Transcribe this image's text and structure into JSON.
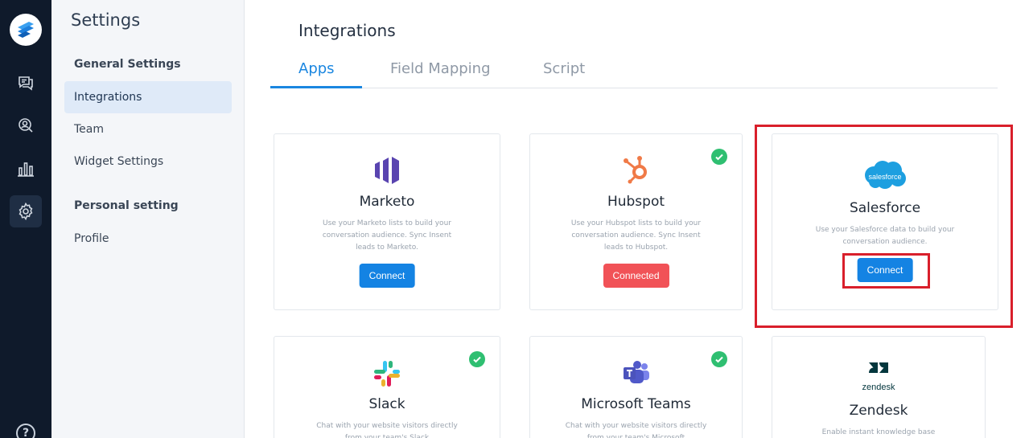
{
  "sidebar": {
    "title": "Settings",
    "groups": [
      {
        "label": "General Settings"
      },
      {
        "label": "Personal setting"
      }
    ],
    "items": [
      {
        "label": "Integrations",
        "active": true
      },
      {
        "label": "Team"
      },
      {
        "label": "Widget Settings"
      },
      {
        "label": "Profile"
      }
    ]
  },
  "rail": {
    "icons": [
      "logo-icon",
      "chat-icon",
      "support-chat-icon",
      "analytics-icon",
      "gear-icon",
      "help-icon"
    ],
    "help_label": "?"
  },
  "main": {
    "title": "Integrations",
    "tabs": [
      {
        "label": "Apps",
        "active": true
      },
      {
        "label": "Field Mapping"
      },
      {
        "label": "Script"
      }
    ],
    "cards": [
      {
        "name": "Marketo",
        "desc": "Use your Marketo lists to build your conversation audience. Sync Insent leads to Marketo.",
        "button": "Connect",
        "connected": false
      },
      {
        "name": "Hubspot",
        "desc": "Use your Hubspot lists to build your conversation audience. Sync Insent leads to Hubspot.",
        "button": "Connected",
        "connected": true
      },
      {
        "name": "Salesforce",
        "logo_text": "salesforce",
        "desc": "Use your Salesforce data to build your conversation audience.",
        "button": "Connect",
        "connected": false
      },
      {
        "name": "Slack",
        "desc": "Chat with your website visitors directly from your team's Slack",
        "connected": true
      },
      {
        "name": "Microsoft Teams",
        "desc": "Chat with your website visitors directly from your team's Microsoft",
        "connected": true
      },
      {
        "name": "Zendesk",
        "logo_text": "zendesk",
        "desc": "Enable instant knowledge base",
        "connected": false
      }
    ]
  },
  "colors": {
    "accent": "#1a86e0",
    "connect_button": "#1483e3",
    "connected_button": "#f15257",
    "check": "#2fbf71",
    "highlight": "#d91f2b",
    "rail_bg": "#0f1a2b"
  }
}
